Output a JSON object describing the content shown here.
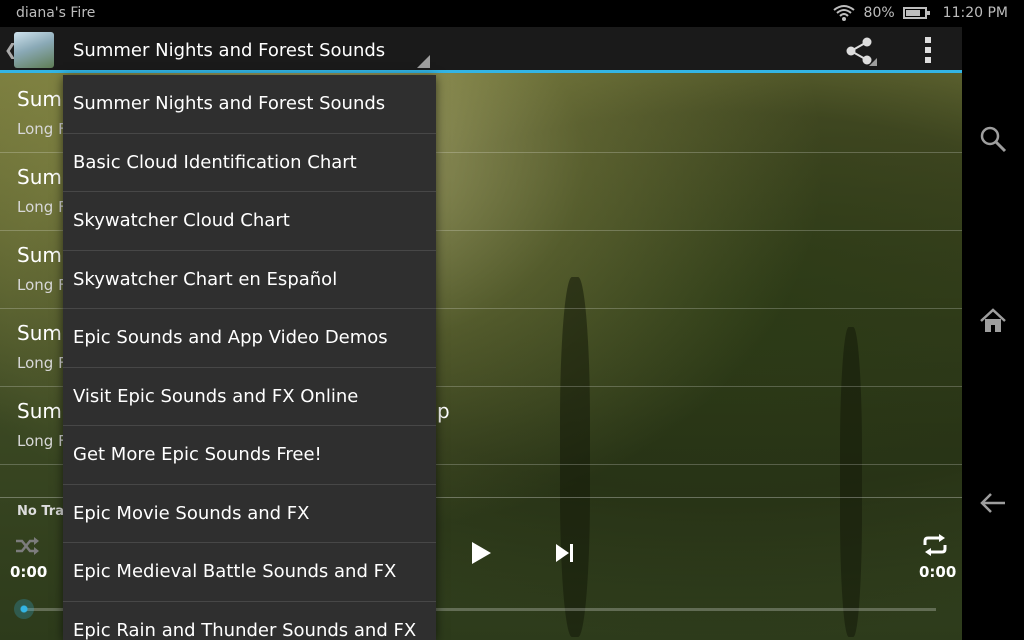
{
  "status_bar": {
    "device_name": "diana's Fire",
    "battery_text": "80%",
    "battery_level_fraction": 0.8,
    "time": "11:20 PM",
    "icons": [
      "wifi-icon",
      "battery-icon"
    ]
  },
  "action_bar": {
    "title": "Summer Nights and Forest Sounds",
    "icons": [
      "up-caret-icon",
      "app-icon",
      "share-icon",
      "overflow-menu-icon"
    ]
  },
  "track_list": [
    {
      "title": "Sum",
      "subtitle": "Long F",
      "tail": ""
    },
    {
      "title": "Sum",
      "subtitle": "Long F",
      "tail": ""
    },
    {
      "title": "Sum",
      "subtitle": "Long F",
      "tail": ""
    },
    {
      "title": "Sum",
      "subtitle": "Long F",
      "tail": ""
    },
    {
      "title": "Sum",
      "subtitle": "Long F",
      "tail": "p"
    }
  ],
  "player": {
    "status": "No Trac",
    "elapsed": "0:00",
    "duration": "0:00",
    "progress_fraction": 0,
    "icons": [
      "shuffle-icon",
      "play-icon",
      "skip-next-icon",
      "repeat-icon"
    ],
    "accent_color": "#33b5e5"
  },
  "dropdown": {
    "options": [
      "Summer Nights and Forest Sounds",
      "Basic Cloud Identification Chart",
      "Skywatcher Cloud Chart",
      "Skywatcher Chart en Español",
      "Epic Sounds and App Video Demos",
      "Visit Epic Sounds and FX Online",
      "Get More Epic Sounds Free!",
      "Epic Movie Sounds and FX",
      "Epic Medieval Battle Sounds and FX",
      "Epic Rain and Thunder Sounds and FX"
    ]
  },
  "system_nav": {
    "icons": [
      "search-icon",
      "home-icon",
      "back-icon"
    ]
  }
}
